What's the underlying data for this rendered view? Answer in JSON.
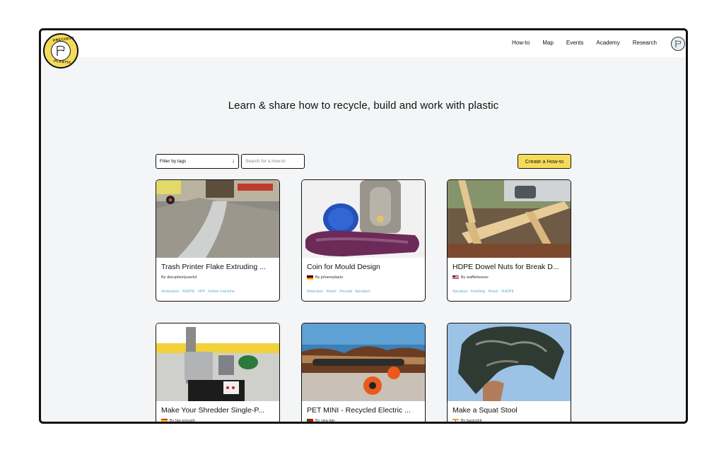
{
  "logo": {
    "top_text": "PRECIOUS",
    "bottom_text": "PLASTIC"
  },
  "nav": [
    {
      "label": "How-to",
      "active": true
    },
    {
      "label": "Map"
    },
    {
      "label": "Events"
    },
    {
      "label": "Academy"
    },
    {
      "label": "Research"
    }
  ],
  "headline": "Learn & share how to recycle, build and work with plastic",
  "filter": {
    "label": "Filter by tags",
    "arrow_icon": "arrow-down-icon"
  },
  "search": {
    "placeholder": "Search for a how-to",
    "value": ""
  },
  "create_button": "Create a How-to",
  "cards": [
    {
      "title": "Trash Printer Flake Extruding ...",
      "author": "By disruptivelyuseful",
      "flag": "none",
      "tags": [
        "#extrusion",
        "#HDPE",
        "#PP",
        "#other machine"
      ]
    },
    {
      "title": "Coin for Mould Design",
      "author": "By johannplasto",
      "flag": "de",
      "tags": [
        "#injection",
        "#hack",
        "#mould",
        "#product"
      ]
    },
    {
      "title": "HDPE Dowel Nuts for Break D...",
      "author": "By wafflebeaver",
      "flag": "us",
      "tags": [
        "#product",
        "#melting",
        "#hack",
        "#HDPE"
      ]
    },
    {
      "title": "Make Your Shredder Single-P...",
      "author": "By fair-enough",
      "flag": "es",
      "tags": []
    },
    {
      "title": "PET MINI - Recycled Electric ...",
      "author": "By viva-lab-",
      "flag": "pt",
      "tags": []
    },
    {
      "title": "Make a Squat Stool",
      "author": "By basicshit",
      "flag": "in",
      "tags": []
    }
  ],
  "colors": {
    "accent_yellow": "#f5db5a",
    "tag_blue": "#5ab1cf",
    "background": "#f4f5f6"
  }
}
